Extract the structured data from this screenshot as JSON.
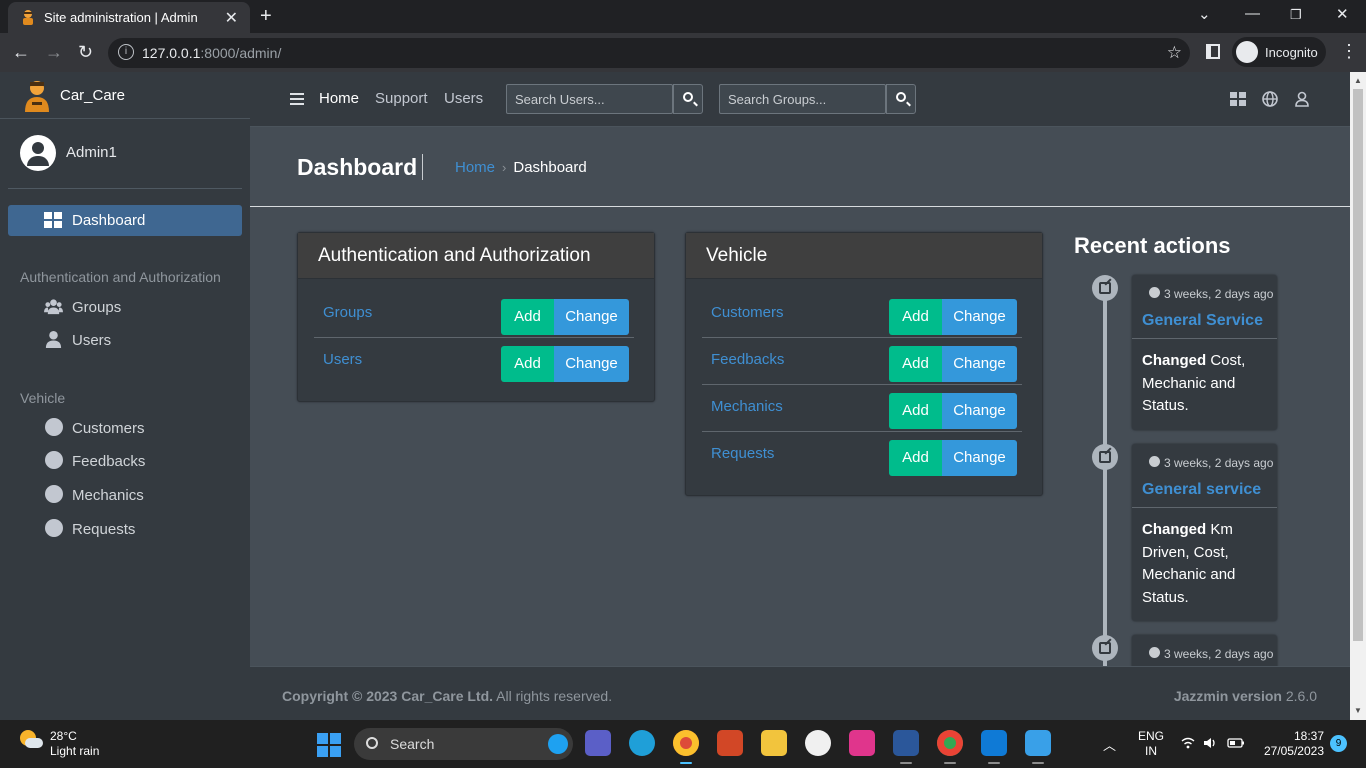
{
  "browser": {
    "tab_title": "Site administration | Admin",
    "url_host": "127.0.0.1",
    "url_rest": ":8000/admin/",
    "incognito_label": "Incognito"
  },
  "sidebar": {
    "brand": "Car_Care",
    "user": "Admin1",
    "dashboard": "Dashboard",
    "sections": [
      {
        "title": "Authentication and Authorization",
        "items": [
          {
            "label": "Groups",
            "icon": "users-icon"
          },
          {
            "label": "Users",
            "icon": "user-icon"
          }
        ]
      },
      {
        "title": "Vehicle",
        "items": [
          {
            "label": "Customers",
            "icon": "circle-icon"
          },
          {
            "label": "Feedbacks",
            "icon": "circle-icon"
          },
          {
            "label": "Mechanics",
            "icon": "circle-icon"
          },
          {
            "label": "Requests",
            "icon": "circle-icon"
          }
        ]
      }
    ]
  },
  "topnav": {
    "links": [
      "Home",
      "Support",
      "Users"
    ],
    "search_users_placeholder": "Search Users...",
    "search_groups_placeholder": "Search Groups..."
  },
  "header": {
    "title": "Dashboard",
    "breadcrumb_home": "Home",
    "breadcrumb_sep": "›",
    "breadcrumb_current": "Dashboard"
  },
  "apps": [
    {
      "title": "Authentication and Authorization",
      "models": [
        "Groups",
        "Users"
      ]
    },
    {
      "title": "Vehicle",
      "models": [
        "Customers",
        "Feedbacks",
        "Mechanics",
        "Requests"
      ]
    }
  ],
  "buttons": {
    "add": "Add",
    "change": "Change"
  },
  "recent": {
    "title": "Recent actions",
    "items": [
      {
        "time": "3 weeks, 2 days ago",
        "object": "General Service",
        "verb": "Changed",
        "detail": " Cost, Mechanic and Status."
      },
      {
        "time": "3 weeks, 2 days ago",
        "object": "General service",
        "verb": "Changed",
        "detail": " Km Driven, Cost, Mechanic and Status."
      },
      {
        "time": "3 weeks, 2 days ago",
        "object": "",
        "verb": "",
        "detail": ""
      }
    ]
  },
  "footer": {
    "copyright_bold": "Copyright © 2023 Car_Care Ltd.",
    "copyright_rest": " All rights reserved.",
    "version_bold": "Jazzmin version",
    "version_num": " 2.6.0"
  },
  "taskbar": {
    "temp": "28°C",
    "weather": "Light rain",
    "search": "Search",
    "lang1": "ENG",
    "lang2": "IN",
    "time": "18:37",
    "date": "27/05/2023",
    "notifications": "9"
  },
  "colors": {
    "accent": "#3f6791",
    "link": "#3f8fd2",
    "add": "#00bc8c",
    "change": "#3498db"
  }
}
